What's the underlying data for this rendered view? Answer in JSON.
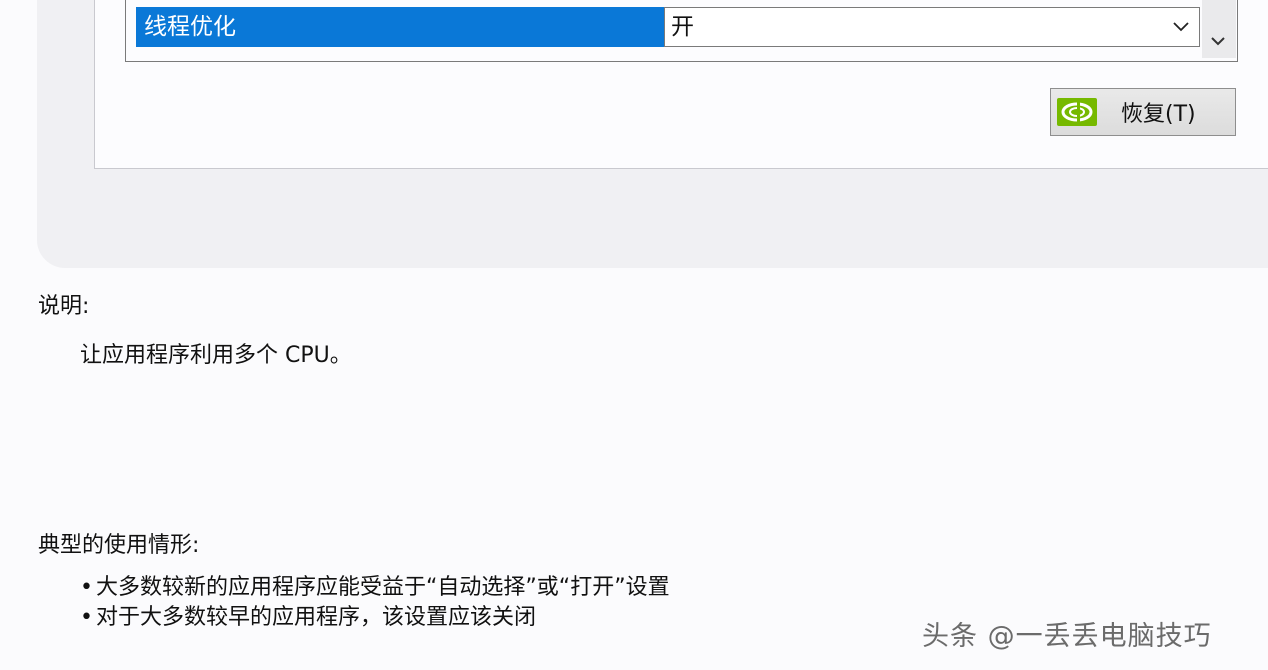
{
  "settings_table": {
    "row": {
      "name": "线程优化",
      "value": "开"
    }
  },
  "restore_button": {
    "label": "恢复(T)"
  },
  "description": {
    "heading": "说明:",
    "text": "让应用程序利用多个 CPU。"
  },
  "typical_usage": {
    "heading": "典型的使用情形:",
    "items": [
      "大多数较新的应用程序应能受益于“自动选择”或“打开”设置",
      "对于大多数较早的应用程序，该设置应该关闭"
    ],
    "bullet": "•"
  },
  "watermark": {
    "text": "头条 @一丢丢电脑技巧"
  },
  "colors": {
    "selected_row": "#0a78d7",
    "nvidia_green": "#76b900",
    "panel_gray": "#f0f0f3"
  }
}
